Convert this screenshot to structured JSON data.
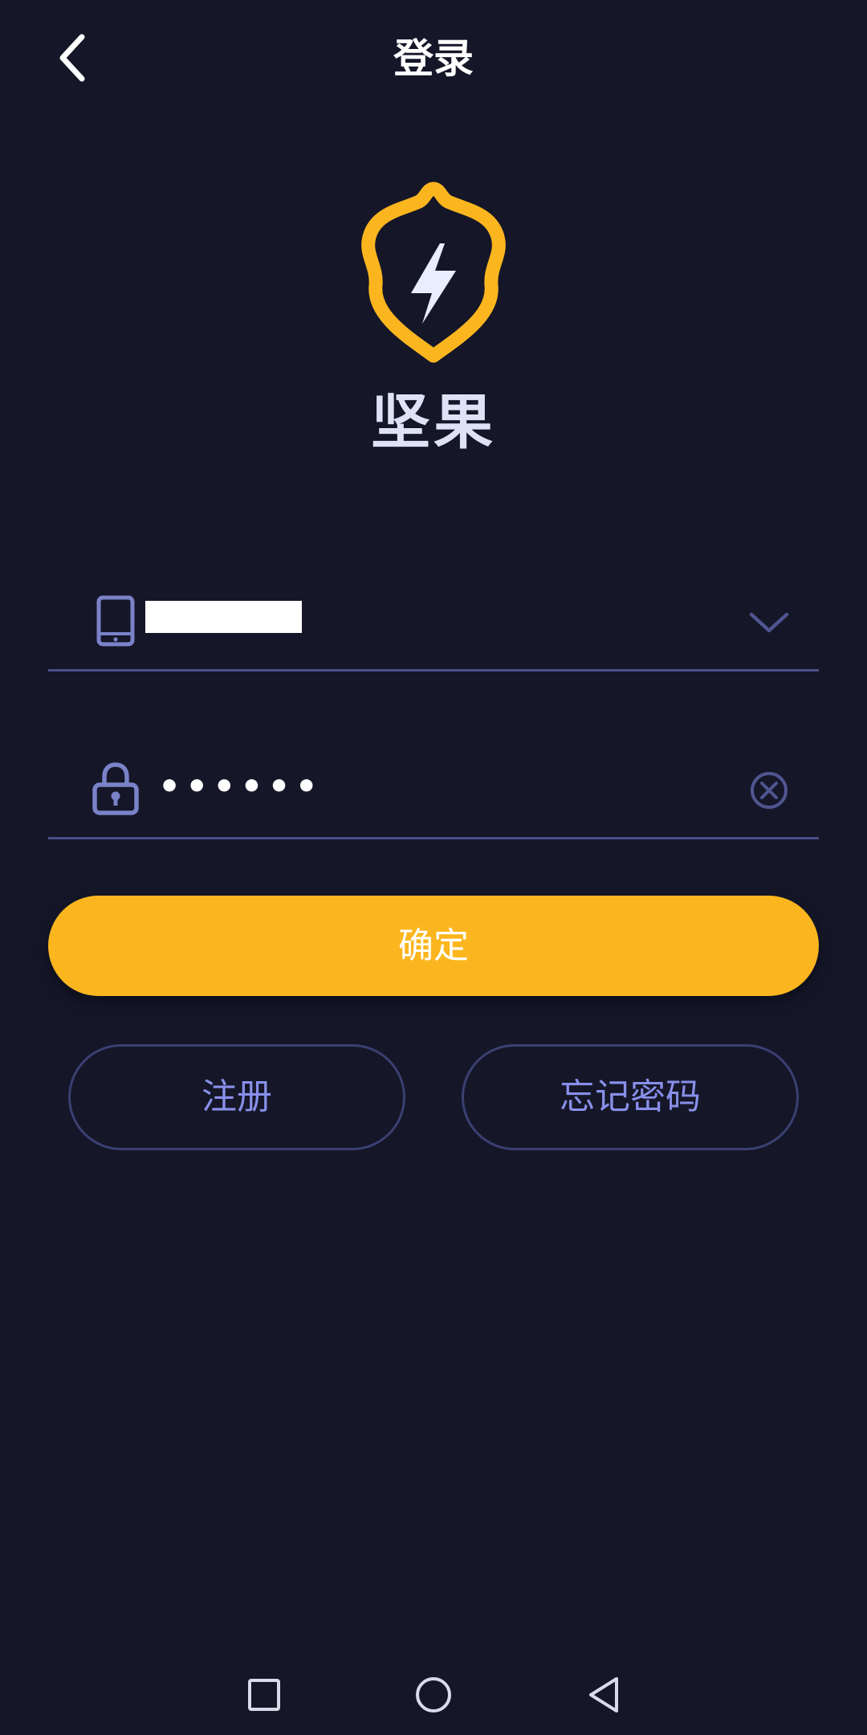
{
  "header": {
    "title": "登录",
    "back_icon": "chevron-left-icon"
  },
  "logo": {
    "icon": "shield-lightning-icon",
    "app_name": "坚果",
    "shield_color": "#fbb61f",
    "bolt_color": "#e8eefc"
  },
  "phone_field": {
    "icon": "phone-icon",
    "value": "",
    "dropdown_icon": "chevron-down-icon"
  },
  "password_field": {
    "icon": "lock-icon",
    "value": "••••••",
    "clear_icon": "clear-circle-icon"
  },
  "actions": {
    "confirm_label": "确定",
    "register_label": "注册",
    "forgot_label": "忘记密码"
  },
  "nav_bar": {
    "recent_icon": "square-icon",
    "home_icon": "circle-icon",
    "back_icon": "triangle-back-icon"
  },
  "colors": {
    "background": "#151628",
    "accent": "#fbb61f",
    "field_icon": "#7a82c8",
    "outline_text": "#8890ea"
  }
}
